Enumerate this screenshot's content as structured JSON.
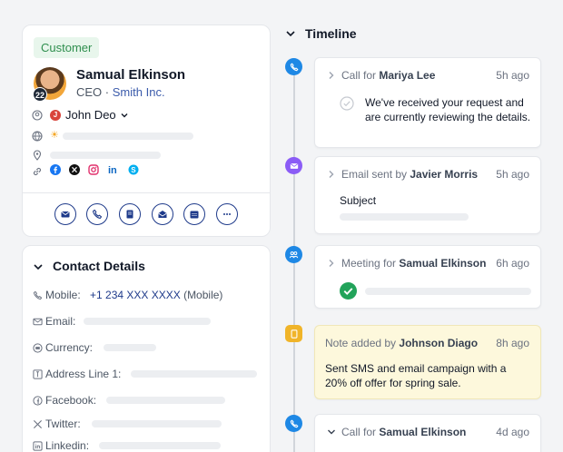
{
  "profile": {
    "badge": "Customer",
    "avatar_badge": "22",
    "name": "Samual Elkinson",
    "title": "CEO",
    "separator": "·",
    "company": "Smith Inc.",
    "owner_initial": "J",
    "owner_name": "John Deo",
    "social_icons": [
      "facebook-icon",
      "x-icon",
      "instagram-icon",
      "linkedin-icon",
      "skype-icon"
    ],
    "actions": [
      "email-icon",
      "call-icon",
      "note-icon",
      "mail-icon",
      "calendar-icon",
      "more-icon"
    ]
  },
  "contact_details": {
    "title": "Contact Details",
    "fields": [
      {
        "label": "Mobile:",
        "value": "+1 234 XXX XXXX",
        "suffix": " (Mobile)"
      },
      {
        "label": "Email:"
      },
      {
        "label": "Currency:"
      },
      {
        "label": "Address Line 1:"
      },
      {
        "label": "Facebook:"
      },
      {
        "label": "Twitter:"
      },
      {
        "label": "Linkedin:"
      }
    ]
  },
  "timeline": {
    "title": "Timeline",
    "items": [
      {
        "type": "call",
        "action": "Call for ",
        "who": "Mariya Lee",
        "time": "5h ago",
        "body": "We've received your request and are currently reviewing the details.",
        "color": "#1e88e5"
      },
      {
        "type": "email",
        "action": "Email sent by ",
        "who": "Javier Morris",
        "time": "5h ago",
        "body": "Subject",
        "color": "#8b5cf6"
      },
      {
        "type": "meeting",
        "action": "Meeting for ",
        "who": "Samual Elkinson",
        "time": "6h ago",
        "color": "#1e88e5"
      },
      {
        "type": "note",
        "action": "Note added by ",
        "who": "Johnson Diago",
        "time": "8h ago",
        "body": "Sent SMS and email campaign with a 20% off offer for spring sale.",
        "color": "#f0b429"
      },
      {
        "type": "call",
        "action": "Call for ",
        "who": "Samual Elkinson",
        "time": "4d ago",
        "color": "#1e88e5"
      }
    ]
  },
  "colors": {
    "accent": "#1e3a8a",
    "success": "#22a35a",
    "customer_badge_bg": "#e8f6ec"
  }
}
